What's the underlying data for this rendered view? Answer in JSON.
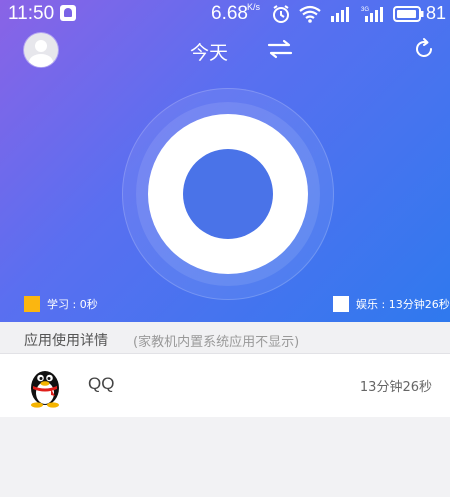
{
  "status_bar": {
    "time": "11:50",
    "speed": "6.68",
    "speed_unit": "K/s",
    "battery": "81",
    "icons": [
      "notification-icon",
      "alarm-icon",
      "wifi-icon",
      "signal-icon",
      "signal-3g-icon",
      "battery-icon"
    ]
  },
  "header": {
    "title": "今天",
    "icons": [
      "avatar",
      "swap-icon",
      "refresh-icon"
    ]
  },
  "legend": {
    "study": "学习 : 0秒",
    "entertainment": "娱乐 : 13分钟26秒",
    "study_color": "#fbb610",
    "entertainment_color": "#ffffff"
  },
  "section": {
    "title": "应用使用详情",
    "note": "(家教机内置系统应用不显示)"
  },
  "apps": [
    {
      "name": "QQ",
      "duration": "13分钟26秒",
      "icon": "qq-penguin-icon"
    }
  ],
  "colors": {
    "gradient_start": "#8a63e6",
    "gradient_end": "#2f79ee",
    "ring_inner": "#4a73e8"
  }
}
